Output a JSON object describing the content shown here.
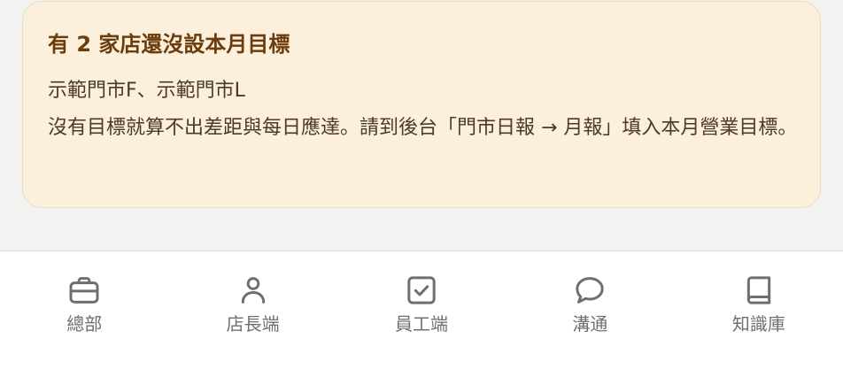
{
  "notice": {
    "title": "有 2 家店還沒設本月目標",
    "stores": "示範門市F、示範門市L",
    "message": "沒有目標就算不出差距與每日應達。請到後台「門市日報 → 月報」填入本月營業目標。"
  },
  "tabs": [
    {
      "label": "總部",
      "icon": "briefcase-icon"
    },
    {
      "label": "店長端",
      "icon": "person-icon"
    },
    {
      "label": "員工端",
      "icon": "checkbox-icon"
    },
    {
      "label": "溝通",
      "icon": "chat-bubble-icon"
    },
    {
      "label": "知識庫",
      "icon": "book-icon"
    }
  ],
  "colors": {
    "notice_background": "#fcefdc",
    "notice_title": "#6b3d0c",
    "tab_icon": "#6f6f6f"
  }
}
